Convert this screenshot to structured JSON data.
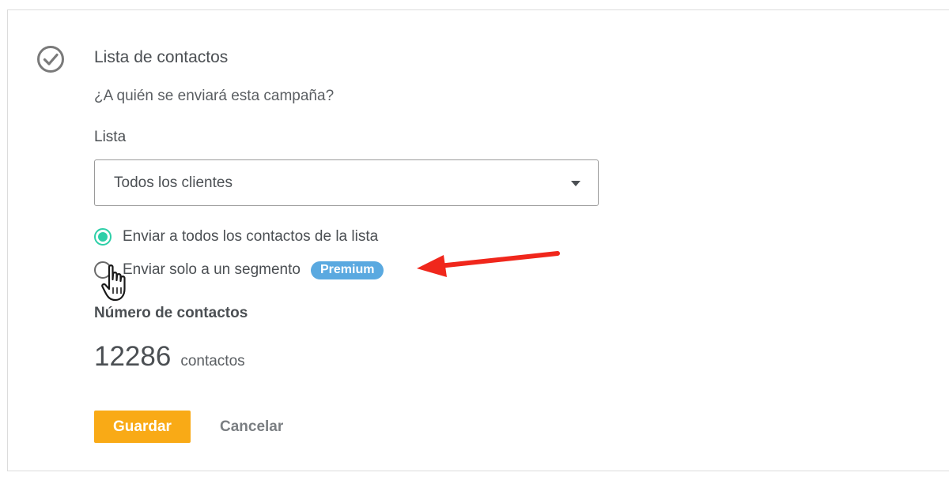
{
  "section": {
    "title": "Lista de contactos",
    "subtitle": "¿A quién se enviará esta campaña?",
    "status_icon": "check-circle-icon"
  },
  "list_field": {
    "label": "Lista",
    "selected": "Todos los clientes"
  },
  "send_options": [
    {
      "label": "Enviar a todos los contactos de la lista",
      "checked": true
    },
    {
      "label": "Enviar solo a un segmento",
      "checked": false,
      "badge": "Premium"
    }
  ],
  "contacts": {
    "label": "Número de contactos",
    "count": "12286",
    "unit": "contactos"
  },
  "actions": {
    "save_label": "Guardar",
    "cancel_label": "Cancelar"
  },
  "colors": {
    "accent_radio": "#2ecfa8",
    "premium_badge": "#5aa9e0",
    "save_button": "#f9aa16",
    "annotation_arrow": "#f0271c"
  }
}
